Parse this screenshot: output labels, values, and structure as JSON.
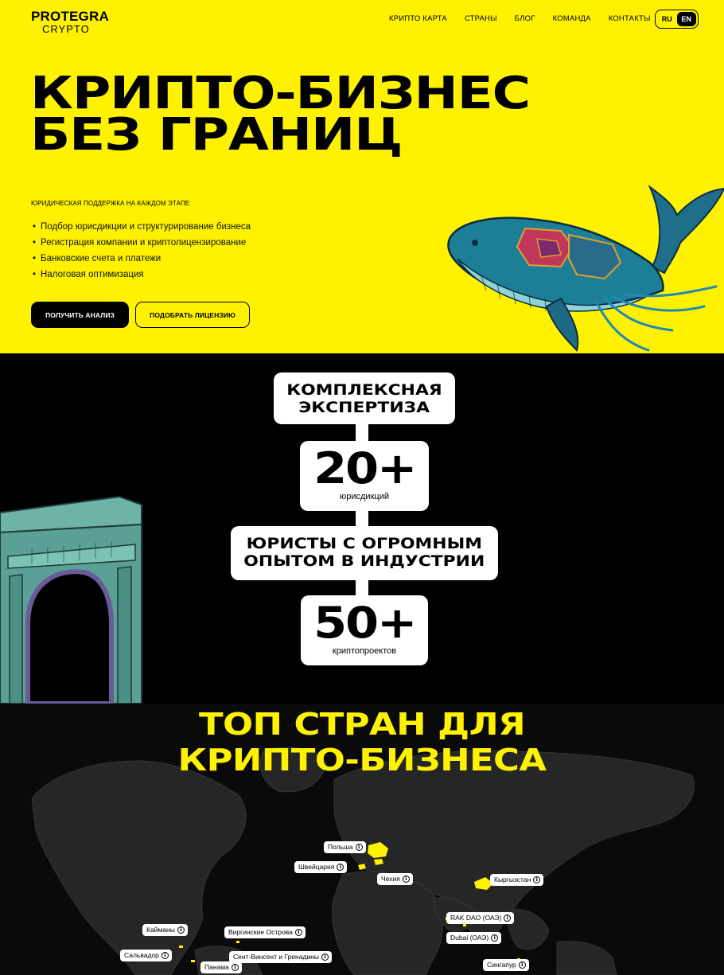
{
  "brand": {
    "line1": "PROTEGRA",
    "line2": "CRYPTO"
  },
  "nav": {
    "items": [
      "КРИПТО КАРТА",
      "СТРАНЫ",
      "БЛОГ",
      "КОМАНДА",
      "КОНТАКТЫ"
    ]
  },
  "lang": {
    "ru": "RU",
    "en": "EN",
    "active": "EN"
  },
  "hero": {
    "title_line1": "КРИПТО-БИЗНЕС",
    "title_line2": "БЕЗ ГРАНИЦ",
    "subtitle": "ЮРИДИЧЕСКАЯ ПОДДЕРЖКА НА КАЖДОМ ЭТАПЕ",
    "features": [
      "Подбор юрисдикции и структурирование бизнеса",
      "Регистрация компании и криптолицензирование",
      "Банковские счета и платежи",
      "Налоговая оптимизация"
    ],
    "primary_button": "ПОЛУЧИТЬ АНАЛИЗ",
    "secondary_button": "ПОДОБРАТЬ ЛИЦЕНЗИЮ"
  },
  "stats": {
    "card1": {
      "line1": "КОМПЛЕКСНАЯ",
      "line2": "ЭКСПЕРТИЗА"
    },
    "card2": {
      "number": "20+",
      "caption": "юрисдикций"
    },
    "card3": {
      "line1": "ЮРИСТЫ С ОГРОМНЫМ",
      "line2": "ОПЫТОМ В ИНДУСТРИИ"
    },
    "card4": {
      "number": "50+",
      "caption": "криптопроектов"
    }
  },
  "map": {
    "title_line1": "ТОП СТРАН ДЛЯ",
    "title_line2": "КРИПТО-БИЗНЕСА",
    "info_glyph": "i",
    "countries": [
      "Польша",
      "Швейцария",
      "Чехия",
      "Кыргызстан",
      "RAK DAO (ОАЭ)",
      "Dubai (ОАЭ)",
      "Кайманы",
      "Виргинские Острова",
      "Сальвадор",
      "Сент-Винсент и Гренадины",
      "Панама",
      "Сингапур"
    ]
  },
  "colors": {
    "accent": "#fff200",
    "dark": "#000000",
    "light": "#ffffff"
  }
}
